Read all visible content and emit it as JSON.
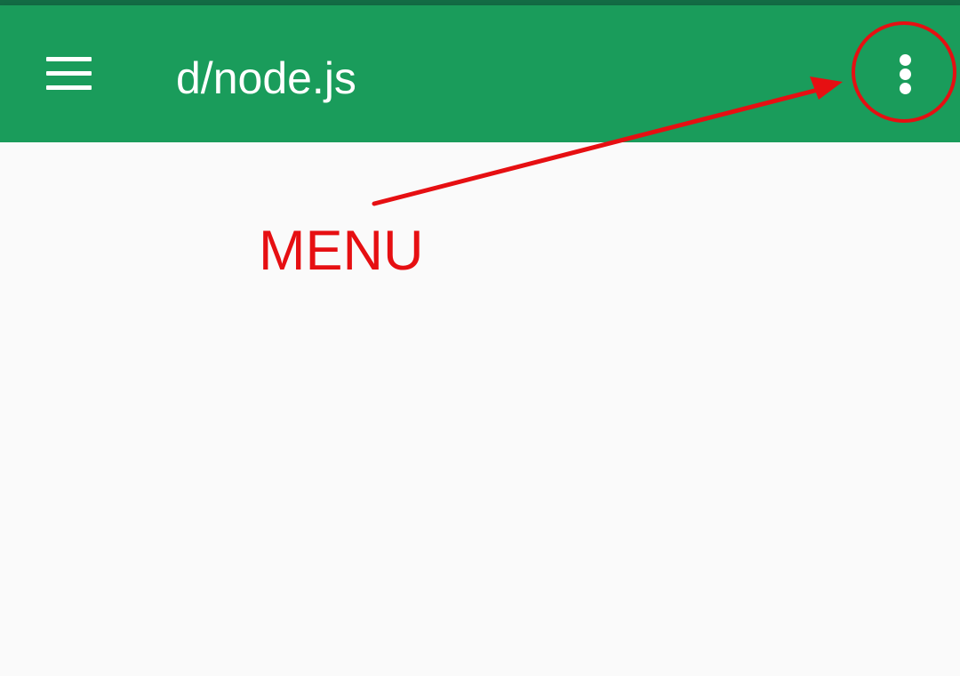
{
  "app_bar": {
    "title": "d/node.js",
    "background_color": "#1a9c5b",
    "status_strip_color": "#136b44",
    "nav_icon": "hamburger-menu-icon",
    "overflow_icon": "more-vert-icon"
  },
  "annotation": {
    "label": "MENU",
    "color": "#e60f12"
  },
  "content": {
    "background_color": "#fafafa"
  }
}
